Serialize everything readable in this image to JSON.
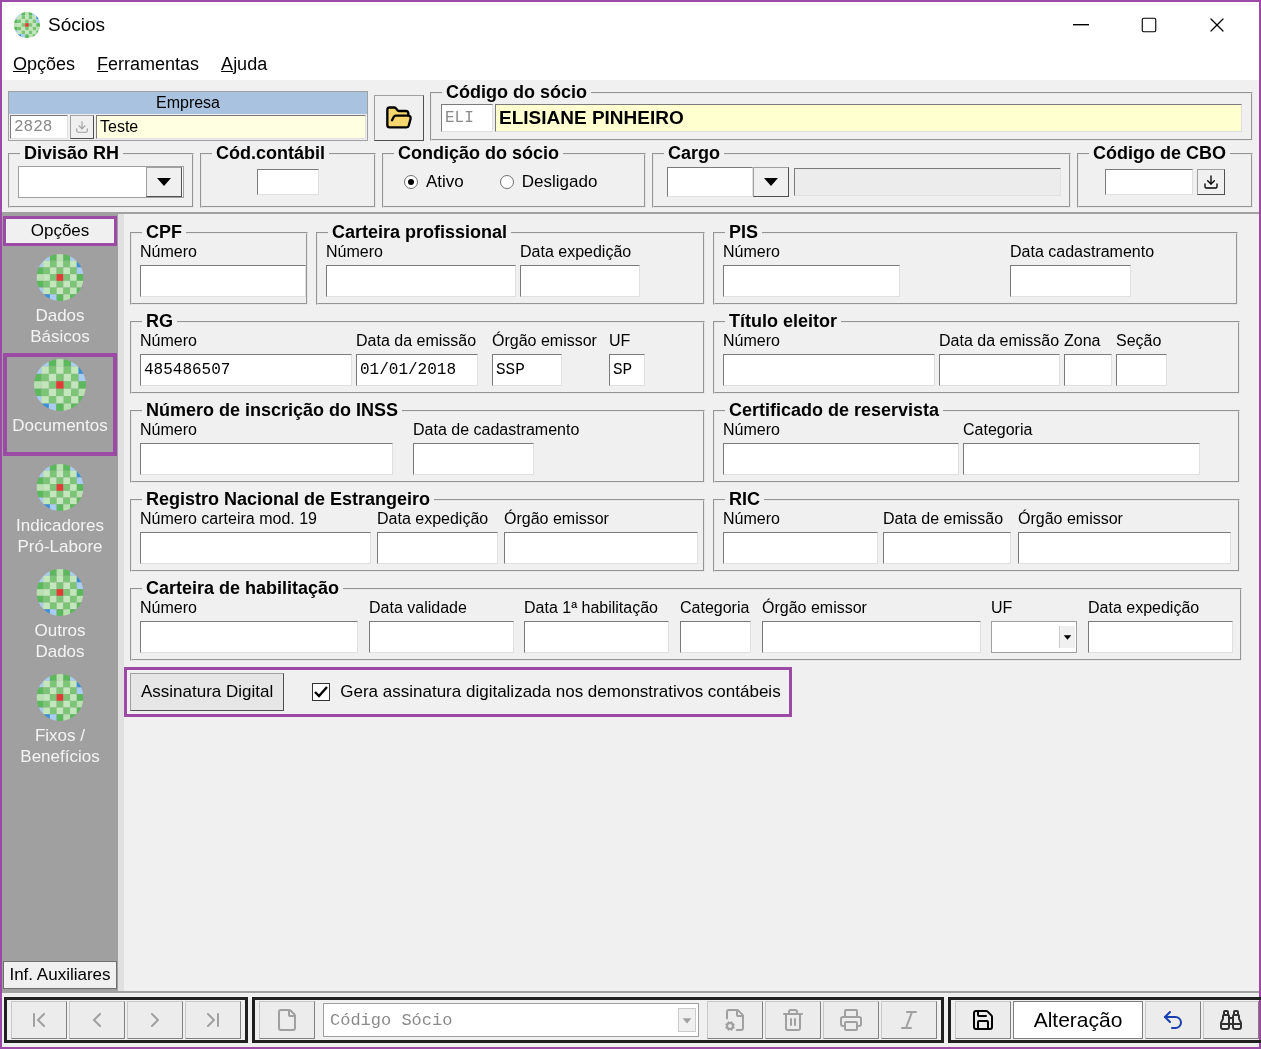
{
  "window": {
    "title": "Sócios"
  },
  "menu": [
    {
      "label": "Opções"
    },
    {
      "label": "Ferramentas"
    },
    {
      "label": "Ajuda"
    }
  ],
  "company": {
    "header": "Empresa",
    "code": "2828",
    "name": "Teste"
  },
  "partner": {
    "title": "Código do sócio",
    "code": "ELI",
    "name": "ELISIANE PINHEIRO"
  },
  "division": {
    "title": "Divisão RH"
  },
  "accounting": {
    "title": "Cód.contábil"
  },
  "condition": {
    "title": "Condição do sócio",
    "options": [
      {
        "label": "Ativo",
        "selected": true
      },
      {
        "label": "Desligado",
        "selected": false
      }
    ]
  },
  "role": {
    "title": "Cargo"
  },
  "cbo": {
    "title": "Código de CBO"
  },
  "sidebar": {
    "title": "Opções",
    "highlighted": true,
    "items": [
      {
        "label": "Dados\nBásicos",
        "selected": false
      },
      {
        "label": "Documentos",
        "selected": true
      },
      {
        "label": "Indicadores\nPró-Labore",
        "selected": false
      },
      {
        "label": "Outros\nDados",
        "selected": false
      },
      {
        "label": "Fixos /\nBenefícios",
        "selected": false
      }
    ],
    "footer": "Inf. Auxiliares"
  },
  "documents": {
    "rows": [
      {
        "groups": [
          {
            "title": "CPF",
            "fields": [
              {
                "label": "Número"
              }
            ]
          },
          {
            "title": "Carteira profissional",
            "fields": [
              {
                "label": "Número"
              },
              {
                "label": "Data expedição"
              }
            ]
          },
          {
            "title": "PIS",
            "fields": [
              {
                "label": "Número"
              },
              {
                "label": "Data cadastramento"
              }
            ]
          }
        ]
      },
      {
        "groups": [
          {
            "title": "RG",
            "fields": [
              {
                "label": "Número",
                "value": "485486507"
              },
              {
                "label": "Data da emissão",
                "value": "01/01/2018"
              },
              {
                "label": "Órgão emissor",
                "value": "SSP"
              },
              {
                "label": "UF",
                "value": "SP"
              }
            ]
          },
          {
            "title": "Título eleitor",
            "fields": [
              {
                "label": "Número"
              },
              {
                "label": "Data da emissão"
              },
              {
                "label": "Zona"
              },
              {
                "label": "Seção"
              }
            ]
          }
        ]
      },
      {
        "groups": [
          {
            "title": "Número de inscrição do INSS",
            "fields": [
              {
                "label": "Número"
              },
              {
                "label": "Data de cadastramento"
              }
            ]
          },
          {
            "title": "Certificado de reservista",
            "fields": [
              {
                "label": "Número"
              },
              {
                "label": "Categoria"
              }
            ]
          }
        ]
      },
      {
        "groups": [
          {
            "title": "Registro Nacional de Estrangeiro",
            "fields": [
              {
                "label": "Número carteira mod. 19"
              },
              {
                "label": "Data expedição"
              },
              {
                "label": "Órgão emissor"
              }
            ]
          },
          {
            "title": "RIC",
            "fields": [
              {
                "label": "Número"
              },
              {
                "label": "Data de emissão"
              },
              {
                "label": "Órgão emissor"
              }
            ]
          }
        ]
      },
      {
        "groups": [
          {
            "title": "Carteira de habilitação",
            "fields": [
              {
                "label": "Número",
                "kind": "text"
              },
              {
                "label": "Data validade",
                "kind": "text"
              },
              {
                "label": "Data 1ª habilitação",
                "kind": "text"
              },
              {
                "label": "Categoria",
                "kind": "text"
              },
              {
                "label": "Órgão emissor",
                "kind": "text"
              },
              {
                "label": "UF",
                "kind": "combo"
              },
              {
                "label": "Data expedição",
                "kind": "text"
              }
            ]
          }
        ]
      }
    ]
  },
  "signature": {
    "highlighted": true,
    "button": "Assinatura Digital",
    "checkbox": {
      "label": "Gera assinatura digitalizada nos demonstrativos contábeis",
      "checked": true
    }
  },
  "toolbar": {
    "search_placeholder": "Código Sócio",
    "mode": "Alteração"
  }
}
